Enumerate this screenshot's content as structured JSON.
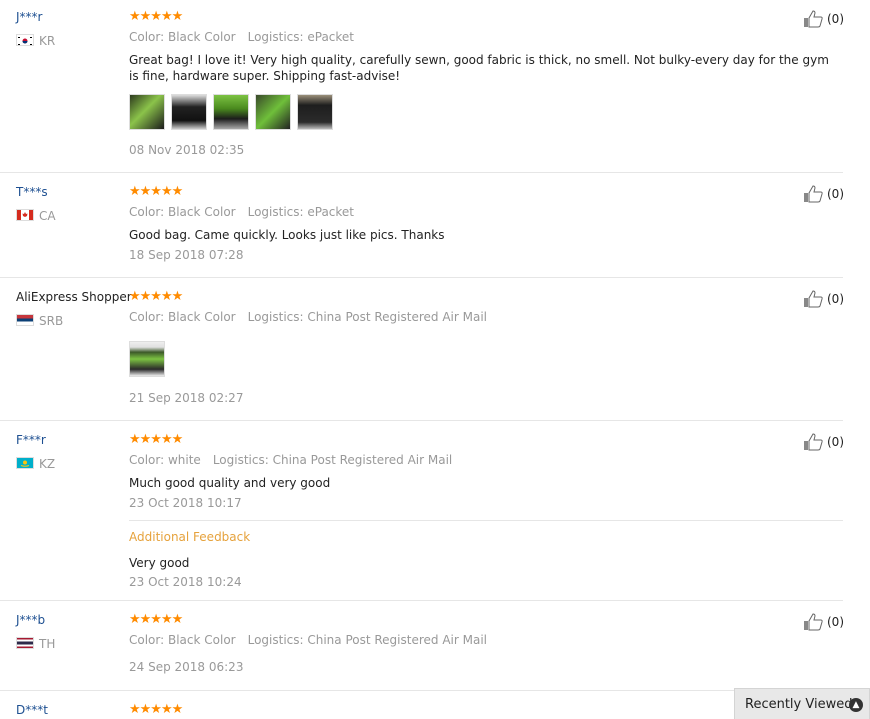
{
  "reviews": [
    {
      "user": "J***r",
      "country": "KR",
      "stars": "★★★★★",
      "color": "Color: Black Color",
      "logistics": "Logistics: ePacket",
      "text": "Great bag! I love it! Very high quality, carefully sewn, good fabric is thick, no smell. Not bulky-every day for the gym is fine, hardware super. Shipping fast-advise!",
      "date": "08 Nov 2018 02:35",
      "helpful": "(0)"
    },
    {
      "user": "T***s",
      "country": "CA",
      "stars": "★★★★★",
      "color": "Color: Black Color",
      "logistics": "Logistics: ePacket",
      "text": "Good bag. Came quickly. Looks just like pics. Thanks",
      "date": "18 Sep 2018 07:28",
      "helpful": "(0)"
    },
    {
      "user": "AliExpress Shopper",
      "country": "SRB",
      "stars": "★★★★★",
      "color": "Color: Black Color",
      "logistics": "Logistics: China Post Registered Air Mail",
      "date": "21 Sep 2018 02:27",
      "helpful": "(0)"
    },
    {
      "user": "F***r",
      "country": "KZ",
      "stars": "★★★★★",
      "color": "Color: white",
      "logistics": "Logistics: China Post Registered Air Mail",
      "text": "Much good quality and very good",
      "date": "23 Oct 2018 10:17",
      "additional_label": "Additional Feedback",
      "additional_text": "Very good",
      "additional_date": "23 Oct 2018 10:24",
      "helpful": "(0)"
    },
    {
      "user": "J***b",
      "country": "TH",
      "stars": "★★★★★",
      "color": "Color: Black Color",
      "logistics": "Logistics: China Post Registered Air Mail",
      "date": "24 Sep 2018 06:23",
      "helpful": "(0)"
    },
    {
      "user": "D***t",
      "stars": "★★★★★"
    }
  ],
  "recently_viewed": "Recently Viewed",
  "colors": {
    "star": "#ff8b00",
    "link": "#1d4f91",
    "additional": "#e6a23c"
  },
  "icons": {
    "helpful": "thumbs-up-icon",
    "recent": "chevron-up-icon"
  }
}
